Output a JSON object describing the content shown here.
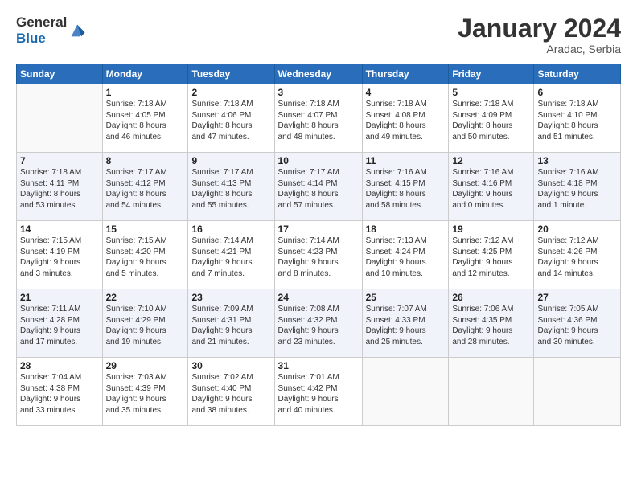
{
  "logo": {
    "general": "General",
    "blue": "Blue"
  },
  "header": {
    "title": "January 2024",
    "location": "Aradac, Serbia"
  },
  "days": [
    "Sunday",
    "Monday",
    "Tuesday",
    "Wednesday",
    "Thursday",
    "Friday",
    "Saturday"
  ],
  "weeks": [
    [
      {
        "num": "",
        "info": ""
      },
      {
        "num": "1",
        "info": "Sunrise: 7:18 AM\nSunset: 4:05 PM\nDaylight: 8 hours\nand 46 minutes."
      },
      {
        "num": "2",
        "info": "Sunrise: 7:18 AM\nSunset: 4:06 PM\nDaylight: 8 hours\nand 47 minutes."
      },
      {
        "num": "3",
        "info": "Sunrise: 7:18 AM\nSunset: 4:07 PM\nDaylight: 8 hours\nand 48 minutes."
      },
      {
        "num": "4",
        "info": "Sunrise: 7:18 AM\nSunset: 4:08 PM\nDaylight: 8 hours\nand 49 minutes."
      },
      {
        "num": "5",
        "info": "Sunrise: 7:18 AM\nSunset: 4:09 PM\nDaylight: 8 hours\nand 50 minutes."
      },
      {
        "num": "6",
        "info": "Sunrise: 7:18 AM\nSunset: 4:10 PM\nDaylight: 8 hours\nand 51 minutes."
      }
    ],
    [
      {
        "num": "7",
        "info": "Sunrise: 7:18 AM\nSunset: 4:11 PM\nDaylight: 8 hours\nand 53 minutes."
      },
      {
        "num": "8",
        "info": "Sunrise: 7:17 AM\nSunset: 4:12 PM\nDaylight: 8 hours\nand 54 minutes."
      },
      {
        "num": "9",
        "info": "Sunrise: 7:17 AM\nSunset: 4:13 PM\nDaylight: 8 hours\nand 55 minutes."
      },
      {
        "num": "10",
        "info": "Sunrise: 7:17 AM\nSunset: 4:14 PM\nDaylight: 8 hours\nand 57 minutes."
      },
      {
        "num": "11",
        "info": "Sunrise: 7:16 AM\nSunset: 4:15 PM\nDaylight: 8 hours\nand 58 minutes."
      },
      {
        "num": "12",
        "info": "Sunrise: 7:16 AM\nSunset: 4:16 PM\nDaylight: 9 hours\nand 0 minutes."
      },
      {
        "num": "13",
        "info": "Sunrise: 7:16 AM\nSunset: 4:18 PM\nDaylight: 9 hours\nand 1 minute."
      }
    ],
    [
      {
        "num": "14",
        "info": "Sunrise: 7:15 AM\nSunset: 4:19 PM\nDaylight: 9 hours\nand 3 minutes."
      },
      {
        "num": "15",
        "info": "Sunrise: 7:15 AM\nSunset: 4:20 PM\nDaylight: 9 hours\nand 5 minutes."
      },
      {
        "num": "16",
        "info": "Sunrise: 7:14 AM\nSunset: 4:21 PM\nDaylight: 9 hours\nand 7 minutes."
      },
      {
        "num": "17",
        "info": "Sunrise: 7:14 AM\nSunset: 4:23 PM\nDaylight: 9 hours\nand 8 minutes."
      },
      {
        "num": "18",
        "info": "Sunrise: 7:13 AM\nSunset: 4:24 PM\nDaylight: 9 hours\nand 10 minutes."
      },
      {
        "num": "19",
        "info": "Sunrise: 7:12 AM\nSunset: 4:25 PM\nDaylight: 9 hours\nand 12 minutes."
      },
      {
        "num": "20",
        "info": "Sunrise: 7:12 AM\nSunset: 4:26 PM\nDaylight: 9 hours\nand 14 minutes."
      }
    ],
    [
      {
        "num": "21",
        "info": "Sunrise: 7:11 AM\nSunset: 4:28 PM\nDaylight: 9 hours\nand 17 minutes."
      },
      {
        "num": "22",
        "info": "Sunrise: 7:10 AM\nSunset: 4:29 PM\nDaylight: 9 hours\nand 19 minutes."
      },
      {
        "num": "23",
        "info": "Sunrise: 7:09 AM\nSunset: 4:31 PM\nDaylight: 9 hours\nand 21 minutes."
      },
      {
        "num": "24",
        "info": "Sunrise: 7:08 AM\nSunset: 4:32 PM\nDaylight: 9 hours\nand 23 minutes."
      },
      {
        "num": "25",
        "info": "Sunrise: 7:07 AM\nSunset: 4:33 PM\nDaylight: 9 hours\nand 25 minutes."
      },
      {
        "num": "26",
        "info": "Sunrise: 7:06 AM\nSunset: 4:35 PM\nDaylight: 9 hours\nand 28 minutes."
      },
      {
        "num": "27",
        "info": "Sunrise: 7:05 AM\nSunset: 4:36 PM\nDaylight: 9 hours\nand 30 minutes."
      }
    ],
    [
      {
        "num": "28",
        "info": "Sunrise: 7:04 AM\nSunset: 4:38 PM\nDaylight: 9 hours\nand 33 minutes."
      },
      {
        "num": "29",
        "info": "Sunrise: 7:03 AM\nSunset: 4:39 PM\nDaylight: 9 hours\nand 35 minutes."
      },
      {
        "num": "30",
        "info": "Sunrise: 7:02 AM\nSunset: 4:40 PM\nDaylight: 9 hours\nand 38 minutes."
      },
      {
        "num": "31",
        "info": "Sunrise: 7:01 AM\nSunset: 4:42 PM\nDaylight: 9 hours\nand 40 minutes."
      },
      {
        "num": "",
        "info": ""
      },
      {
        "num": "",
        "info": ""
      },
      {
        "num": "",
        "info": ""
      }
    ]
  ]
}
